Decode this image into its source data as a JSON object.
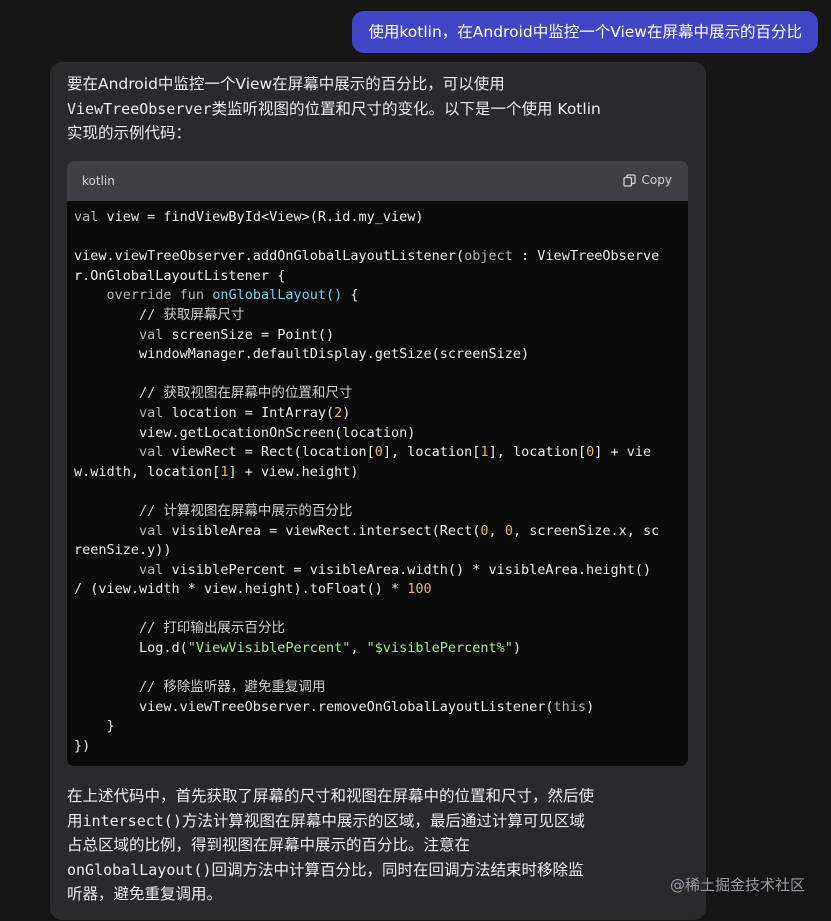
{
  "user_message": "使用kotlin，在Android中监控一个View在屏幕中展示的百分比",
  "assistant": {
    "intro_lines": [
      {
        "text": "要在Android中监控一个View在屏幕中展示的百分比，可以使用"
      },
      {
        "mono": "ViewTreeObserver",
        "text": "类监听视图的位置和尺寸的变化。以下是一个使用 Kotlin"
      },
      {
        "text": "实现的示例代码："
      }
    ],
    "code": {
      "language": "kotlin",
      "copy_label": "Copy",
      "lines": [
        [
          {
            "t": "val",
            "c": "kw"
          },
          {
            "t": " view = findViewById<View>(R.id.my_view)"
          }
        ],
        [],
        [
          {
            "t": "view.viewTreeObserver.addOnGlobalLayoutListener("
          },
          {
            "t": "object",
            "c": "kw"
          },
          {
            "t": " : ViewTreeObserve"
          }
        ],
        [
          {
            "t": "r.OnGlobalLayoutListener {"
          }
        ],
        [
          {
            "t": "    "
          },
          {
            "t": "override fun",
            "c": "kw"
          },
          {
            "t": " "
          },
          {
            "t": "onGlobalLayout()",
            "c": "fn"
          },
          {
            "t": " {"
          }
        ],
        [
          {
            "t": "        "
          },
          {
            "t": "// 获取屏幕尺寸",
            "c": "cm"
          }
        ],
        [
          {
            "t": "        "
          },
          {
            "t": "val",
            "c": "kw"
          },
          {
            "t": " screenSize = Point()"
          }
        ],
        [
          {
            "t": "        windowManager.defaultDisplay.getSize(screenSize)"
          }
        ],
        [],
        [
          {
            "t": "        "
          },
          {
            "t": "// 获取视图在屏幕中的位置和尺寸",
            "c": "cm"
          }
        ],
        [
          {
            "t": "        "
          },
          {
            "t": "val",
            "c": "kw"
          },
          {
            "t": " location = IntArray("
          },
          {
            "t": "2",
            "c": "num"
          },
          {
            "t": ")"
          }
        ],
        [
          {
            "t": "        view.getLocationOnScreen(location)"
          }
        ],
        [
          {
            "t": "        "
          },
          {
            "t": "val",
            "c": "kw"
          },
          {
            "t": " viewRect = Rect(location["
          },
          {
            "t": "0",
            "c": "num"
          },
          {
            "t": "], location["
          },
          {
            "t": "1",
            "c": "num"
          },
          {
            "t": "], location["
          },
          {
            "t": "0",
            "c": "num"
          },
          {
            "t": "] + vie"
          }
        ],
        [
          {
            "t": "w.width, location["
          },
          {
            "t": "1",
            "c": "num"
          },
          {
            "t": "] + view.height)"
          }
        ],
        [],
        [
          {
            "t": "        "
          },
          {
            "t": "// 计算视图在屏幕中展示的百分比",
            "c": "cm"
          }
        ],
        [
          {
            "t": "        "
          },
          {
            "t": "val",
            "c": "kw"
          },
          {
            "t": " visibleArea = viewRect.intersect(Rect("
          },
          {
            "t": "0",
            "c": "num"
          },
          {
            "t": ", "
          },
          {
            "t": "0",
            "c": "num"
          },
          {
            "t": ", screenSize.x, sc"
          }
        ],
        [
          {
            "t": "reenSize.y))"
          }
        ],
        [
          {
            "t": "        "
          },
          {
            "t": "val",
            "c": "kw"
          },
          {
            "t": " visiblePercent = visibleArea.width() * visibleArea.height()"
          }
        ],
        [
          {
            "t": "/ (view.width * view.height).toFloat() * "
          },
          {
            "t": "100",
            "c": "num"
          }
        ],
        [],
        [
          {
            "t": "        "
          },
          {
            "t": "// 打印输出展示百分比",
            "c": "cm"
          }
        ],
        [
          {
            "t": "        Log.d("
          },
          {
            "t": "\"ViewVisiblePercent\"",
            "c": "str"
          },
          {
            "t": ", "
          },
          {
            "t": "\"$visiblePercent%\"",
            "c": "str"
          },
          {
            "t": ")"
          }
        ],
        [],
        [
          {
            "t": "        "
          },
          {
            "t": "// 移除监听器，避免重复调用",
            "c": "cm"
          }
        ],
        [
          {
            "t": "        view.viewTreeObserver.removeOnGlobalLayoutListener("
          },
          {
            "t": "this",
            "c": "kw"
          },
          {
            "t": ")"
          }
        ],
        [
          {
            "t": "    }"
          }
        ],
        [
          {
            "t": "})"
          }
        ]
      ]
    },
    "outro_lines": [
      {
        "text": "在上述代码中，首先获取了屏幕的尺寸和视图在屏幕中的位置和尺寸，然后使"
      },
      {
        "text": "用",
        "mono": "intersect()",
        "after": "方法计算视图在屏幕中展示的区域，最后通过计算可见区域"
      },
      {
        "text": "占总区域的比例，得到视图在屏幕中展示的百分比。注意在"
      },
      {
        "mono": "onGlobalLayout()",
        "text": "回调方法中计算百分比，同时在回调方法结束时移除监"
      },
      {
        "text": "听器，避免重复调用。"
      }
    ]
  },
  "watermark": "@稀土掘金技术社区",
  "icons": {
    "copy": "copy-icon"
  }
}
